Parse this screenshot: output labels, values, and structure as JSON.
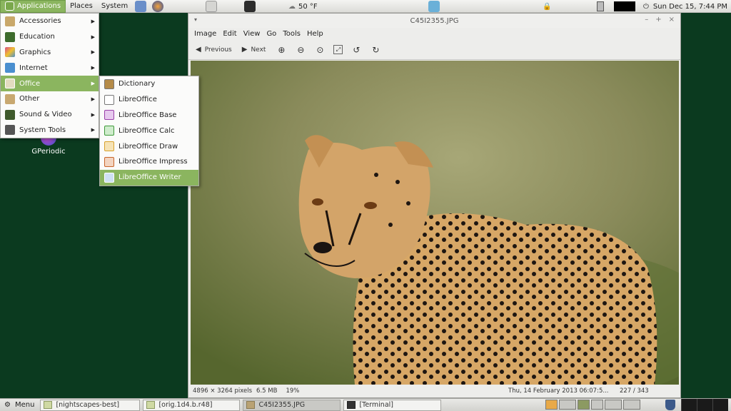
{
  "top_panel": {
    "applications": "Applications",
    "places": "Places",
    "system": "System",
    "weather": "50 °F",
    "clock": "Sun Dec 15,  7:44 PM"
  },
  "app_menu": {
    "items": [
      {
        "label": "Accessories",
        "color": "#c9a86a"
      },
      {
        "label": "Education",
        "color": "#3d6b2c"
      },
      {
        "label": "Graphics",
        "color": "#d84a8b"
      },
      {
        "label": "Internet",
        "color": "#4a8fcf"
      },
      {
        "label": "Office",
        "color": "#7aa84c"
      },
      {
        "label": "Other",
        "color": "#c8a870"
      },
      {
        "label": "Sound & Video",
        "color": "#3f5a2c"
      },
      {
        "label": "System Tools",
        "color": "#555555"
      }
    ],
    "selected_index": 4
  },
  "office_menu": {
    "items": [
      {
        "label": "Dictionary",
        "color": "#b58b48"
      },
      {
        "label": "LibreOffice",
        "color": "#ffffff"
      },
      {
        "label": "LibreOffice Base",
        "color": "#9a3fa8"
      },
      {
        "label": "LibreOffice Calc",
        "color": "#3f9a3a"
      },
      {
        "label": "LibreOffice Draw",
        "color": "#d8a12d"
      },
      {
        "label": "LibreOffice Impress",
        "color": "#c8642a"
      },
      {
        "label": "LibreOffice Writer",
        "color": "#3b6fb0"
      }
    ],
    "selected_index": 6
  },
  "desktop": {
    "gperiodic_label": "GPeriodic"
  },
  "viewer": {
    "title": "C45I2355.JPG",
    "menu": [
      "Image",
      "Edit",
      "View",
      "Go",
      "Tools",
      "Help"
    ],
    "toolbar": {
      "previous": "Previous",
      "next": "Next"
    },
    "status": {
      "dimensions": "4896 × 3264 pixels",
      "size": "6.5 MB",
      "zoom": "19%",
      "date": "Thu, 14 February 2013  06:07:5...",
      "position": "227 / 343"
    }
  },
  "bottom_panel": {
    "menu": "Menu",
    "tasks": [
      {
        "label": "[nightscapes-best]",
        "active": false
      },
      {
        "label": "[orig.1d4.b.r48]",
        "active": false
      },
      {
        "label": "C45I2355.JPG",
        "active": true
      },
      {
        "label": "[Terminal]",
        "active": false
      }
    ]
  },
  "colors": {
    "accent": "#8bb55f",
    "desktop": "#0b3a1f"
  }
}
